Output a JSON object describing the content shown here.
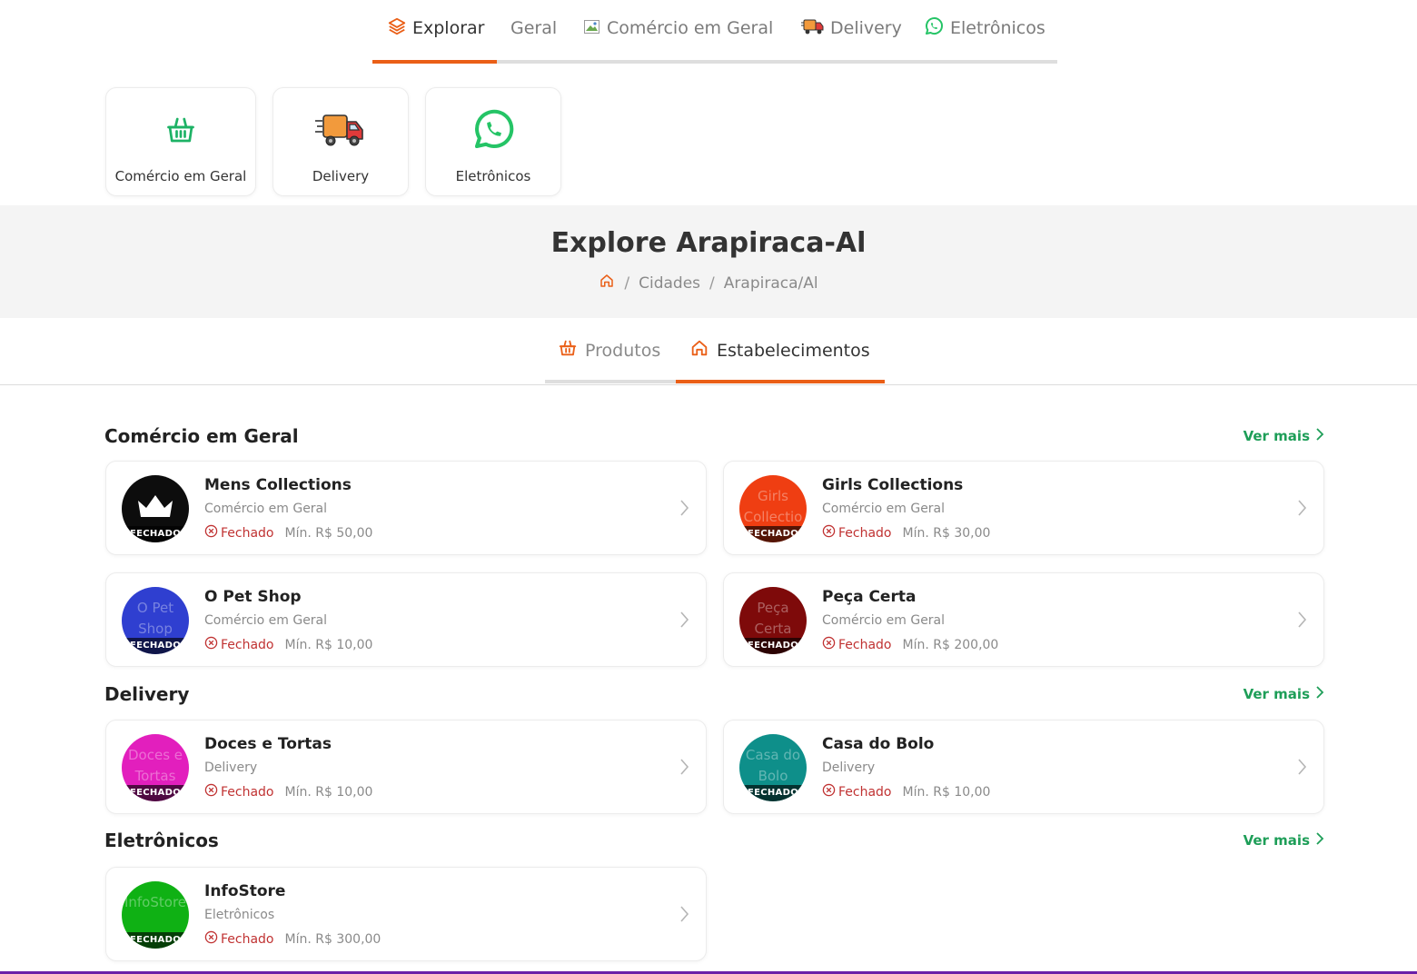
{
  "topnav": {
    "items": [
      {
        "label": "Explorar",
        "icon": "layers-icon"
      },
      {
        "label": "Geral",
        "icon": ""
      },
      {
        "label": "Comércio em Geral",
        "icon": "broken-image-icon"
      },
      {
        "label": "Delivery",
        "icon": "truck-icon"
      },
      {
        "label": "Eletrônicos",
        "icon": "whatsapp-icon"
      }
    ],
    "active_index": 0
  },
  "categories": [
    {
      "label": "Comércio em Geral",
      "icon": "basket-icon"
    },
    {
      "label": "Delivery",
      "icon": "truck-icon"
    },
    {
      "label": "Eletrônicos",
      "icon": "whatsapp-icon"
    }
  ],
  "hero": {
    "title": "Explore Arapiraca-Al",
    "breadcrumb": [
      "Cidades",
      "Arapiraca/Al"
    ],
    "separator": "/"
  },
  "subtabs": {
    "items": [
      {
        "label": "Produtos",
        "icon": "basket-icon"
      },
      {
        "label": "Estabelecimentos",
        "icon": "home-icon"
      }
    ],
    "active_index": 1
  },
  "sections": [
    {
      "title": "Comércio em Geral",
      "ver_mais": "Ver mais",
      "stores": [
        {
          "name": "Mens Collections",
          "category": "Comércio em Geral",
          "status": "Fechado",
          "min": "Mín. R$ 50,00",
          "logo_color": "#0d0d0d",
          "logo_alt": "",
          "badge": "FECHADO"
        },
        {
          "name": "Girls Collections",
          "category": "Comércio em Geral",
          "status": "Fechado",
          "min": "Mín. R$ 30,00",
          "logo_color": "#ef3e12",
          "logo_alt": "Girls Collectio",
          "badge": "FECHADO"
        },
        {
          "name": "O Pet Shop",
          "category": "Comércio em Geral",
          "status": "Fechado",
          "min": "Mín. R$ 10,00",
          "logo_color": "#2f3fd0",
          "logo_alt": "O Pet Shop",
          "badge": "FECHADO"
        },
        {
          "name": "Peça Certa",
          "category": "Comércio em Geral",
          "status": "Fechado",
          "min": "Mín. R$ 200,00",
          "logo_color": "#7e0a0a",
          "logo_alt": "Peça Certa",
          "badge": "FECHADO"
        }
      ]
    },
    {
      "title": "Delivery",
      "ver_mais": "Ver mais",
      "stores": [
        {
          "name": "Doces e Tortas",
          "category": "Delivery",
          "status": "Fechado",
          "min": "Mín. R$ 10,00",
          "logo_color": "#e21fbd",
          "logo_alt": "Doces e Tortas",
          "badge": "FECHADO"
        },
        {
          "name": "Casa do Bolo",
          "category": "Delivery",
          "status": "Fechado",
          "min": "Mín. R$ 10,00",
          "logo_color": "#0e8f8a",
          "logo_alt": "Casa do Bolo",
          "badge": "FECHADO"
        }
      ]
    },
    {
      "title": "Eletrônicos",
      "ver_mais": "Ver mais",
      "stores": [
        {
          "name": "InfoStore",
          "category": "Eletrônicos",
          "status": "Fechado",
          "min": "Mín. R$ 300,00",
          "logo_color": "#0fb114",
          "logo_alt": "InfoStore",
          "badge": "FECHADO"
        }
      ]
    }
  ],
  "colors": {
    "accent": "#ea5f17",
    "link_green": "#1e9e58",
    "closed_red": "#c03232",
    "bottom_bar": "#6a1fa8"
  }
}
